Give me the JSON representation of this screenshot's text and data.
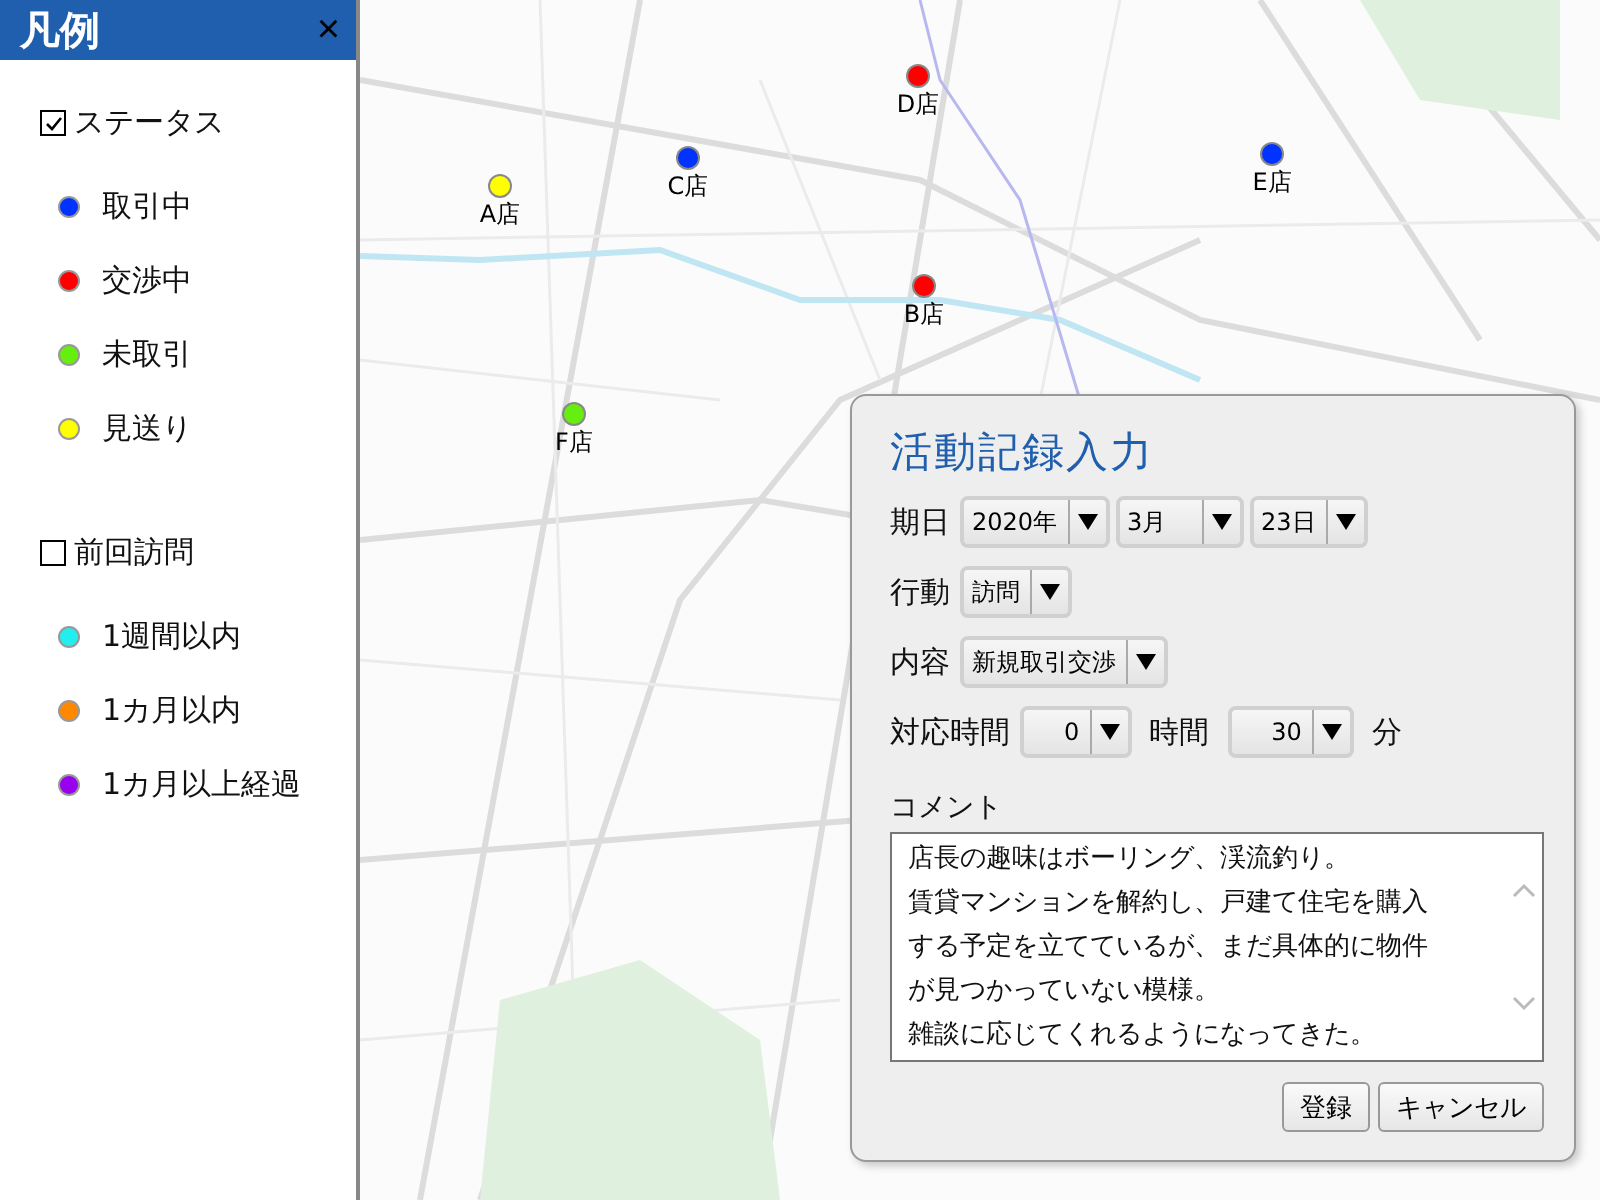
{
  "legend": {
    "title": "凡例",
    "close": "×",
    "groups": [
      {
        "label": "ステータス",
        "checked": true,
        "items": [
          {
            "label": "取引中",
            "color": "#0033ff"
          },
          {
            "label": "交渉中",
            "color": "#ff0000"
          },
          {
            "label": "未取引",
            "color": "#66ee11"
          },
          {
            "label": "見送り",
            "color": "#ffff00"
          }
        ]
      },
      {
        "label": "前回訪問",
        "checked": false,
        "items": [
          {
            "label": "1週間以内",
            "color": "#22eeee"
          },
          {
            "label": "1カ月以内",
            "color": "#ff8800"
          },
          {
            "label": "1カ月以上経過",
            "color": "#9900ee"
          }
        ]
      }
    ]
  },
  "map": {
    "stores": [
      {
        "label": "A店",
        "color": "#ffff00"
      },
      {
        "label": "C店",
        "color": "#0033ff"
      },
      {
        "label": "D店",
        "color": "#ff0000"
      },
      {
        "label": "B店",
        "color": "#ff0000"
      },
      {
        "label": "E店",
        "color": "#0033ff"
      },
      {
        "label": "F店",
        "color": "#66ee11"
      }
    ]
  },
  "dialog": {
    "title": "活動記録入力",
    "date": {
      "label": "期日",
      "year": "2020年",
      "month": "3月",
      "day": "23日"
    },
    "action": {
      "label": "行動",
      "value": "訪問"
    },
    "content": {
      "label": "内容",
      "value": "新規取引交渉"
    },
    "duration": {
      "label": "対応時間",
      "hours": "0",
      "hours_unit": "時間",
      "minutes": "30",
      "minutes_unit": "分"
    },
    "comment": {
      "label": "コメント",
      "lines": [
        "店長の趣味はボーリング、渓流釣り。",
        "賃貸マンションを解約し、戸建て住宅を購入",
        "する予定を立てているが、まだ具体的に物件",
        "が見つかっていない模様。",
        "雑談に応じてくれるようになってきた。"
      ]
    },
    "buttons": [
      "登録",
      "キャンセル"
    ]
  }
}
